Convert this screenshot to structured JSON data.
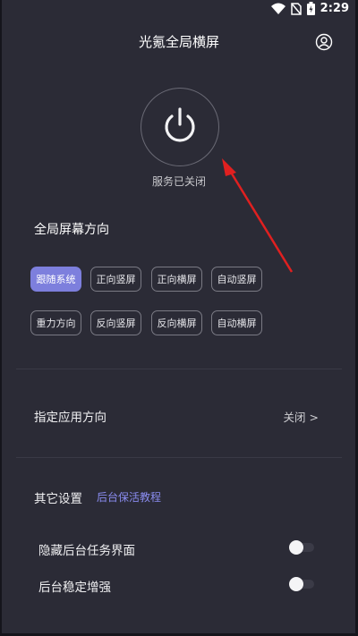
{
  "status_bar": {
    "time": "2:29"
  },
  "header": {
    "title": "光氪全局横屏"
  },
  "power": {
    "status": "服务已关闭"
  },
  "orientation": {
    "heading": "全局屏幕方向",
    "row1": [
      "跟随系统",
      "正向竖屏",
      "正向横屏",
      "自动竖屏"
    ],
    "row2": [
      "重力方向",
      "反向竖屏",
      "反向横屏",
      "自动横屏"
    ],
    "active": "跟随系统",
    "colors": {
      "active_bg": "#7d7fdd"
    }
  },
  "app_orientation": {
    "label": "指定应用方向",
    "value": "关闭 >"
  },
  "other": {
    "heading": "其它设置",
    "link": "后台保活教程",
    "toggle1": {
      "label": "隐藏后台任务界面",
      "state": "off"
    },
    "toggle2": {
      "label": "后台稳定增强",
      "state": "off"
    }
  }
}
